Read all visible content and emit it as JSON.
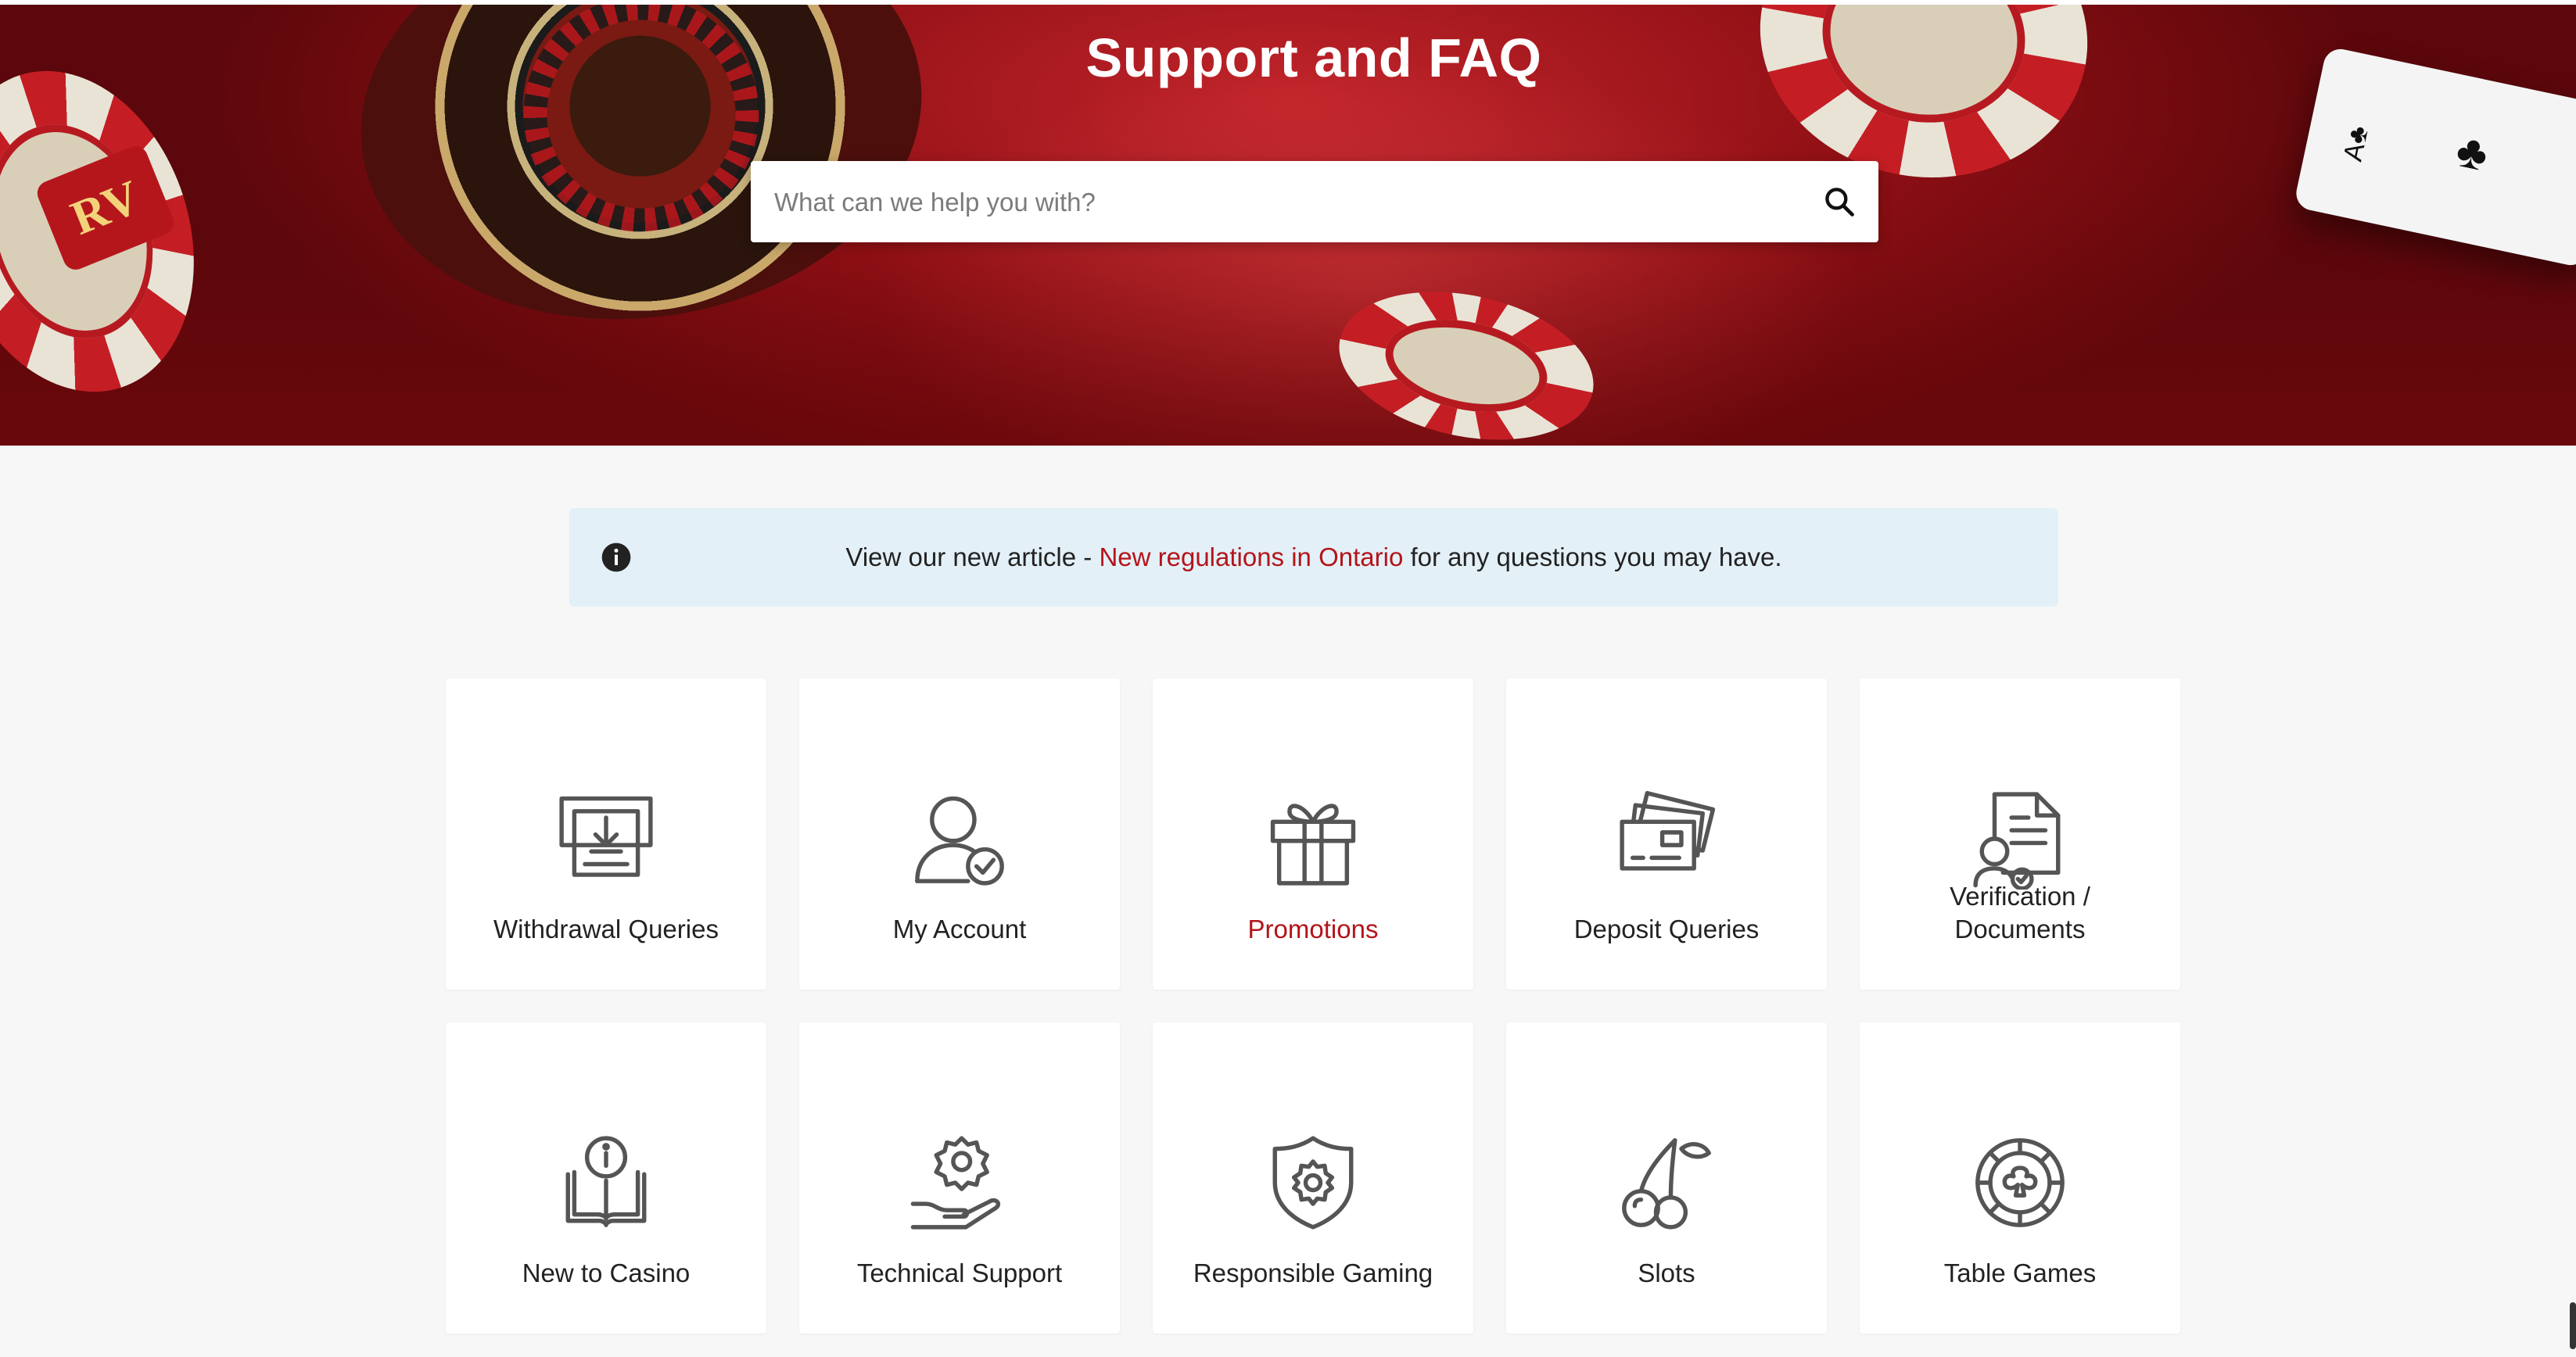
{
  "hero": {
    "title": "Support and FAQ",
    "search_placeholder": "What can we help you with?",
    "search_icon": "search-icon"
  },
  "notice": {
    "prefix": "View our new article - ",
    "link": "New regulations in Ontario",
    "suffix": " for any questions you may have.",
    "icon": "info-icon"
  },
  "colors": {
    "brand_red": "#b3141a",
    "notice_bg": "#e4f0f7",
    "page_bg": "#f7f7f7",
    "icon_gray": "#555555"
  },
  "categories": [
    {
      "label": "Withdrawal Queries",
      "icon": "atm-icon"
    },
    {
      "label": "My Account",
      "icon": "user-check-icon"
    },
    {
      "label": "Promotions",
      "icon": "gift-icon",
      "active": true
    },
    {
      "label": "Deposit Queries",
      "icon": "credit-cards-icon"
    },
    {
      "label": "Verification / Documents",
      "line1": "Verification /",
      "line2": "Documents",
      "icon": "document-user-icon"
    },
    {
      "label": "New to Casino",
      "icon": "info-book-icon"
    },
    {
      "label": "Technical Support",
      "icon": "gear-hand-icon"
    },
    {
      "label": "Responsible Gaming",
      "icon": "shield-gear-icon"
    },
    {
      "label": "Slots",
      "icon": "cherries-icon"
    },
    {
      "label": "Table Games",
      "icon": "roulette-chip-icon"
    }
  ]
}
